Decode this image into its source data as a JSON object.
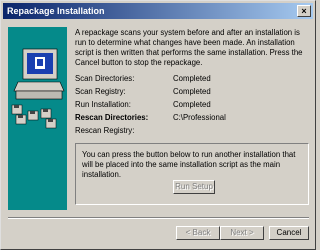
{
  "window": {
    "title": "Repackage Installation",
    "close_glyph": "×"
  },
  "intro": "A repackage scans your system before and after an installation is run to determine what changes have been made. An installation script is then written that performs the same installation. Press the Cancel button to stop the repackage.",
  "status": [
    {
      "label": "Scan Directories:",
      "value": "Completed"
    },
    {
      "label": "Scan Registry:",
      "value": "Completed"
    },
    {
      "label": "Run Installation:",
      "value": "Completed"
    },
    {
      "label": "Rescan Directories:",
      "value": "C:\\Professional"
    },
    {
      "label": "Rescan Registry:",
      "value": ""
    }
  ],
  "group": {
    "text": "You can press the button below to run another installation that will be placed into the same installation script as the main installation.",
    "run_setup_label": "Run Setup"
  },
  "buttons": {
    "back": "< Back",
    "next": "Next >",
    "cancel": "Cancel"
  },
  "art": {
    "icon_names": [
      "computer-icon",
      "disks-icon"
    ],
    "background": "#058a8a"
  }
}
